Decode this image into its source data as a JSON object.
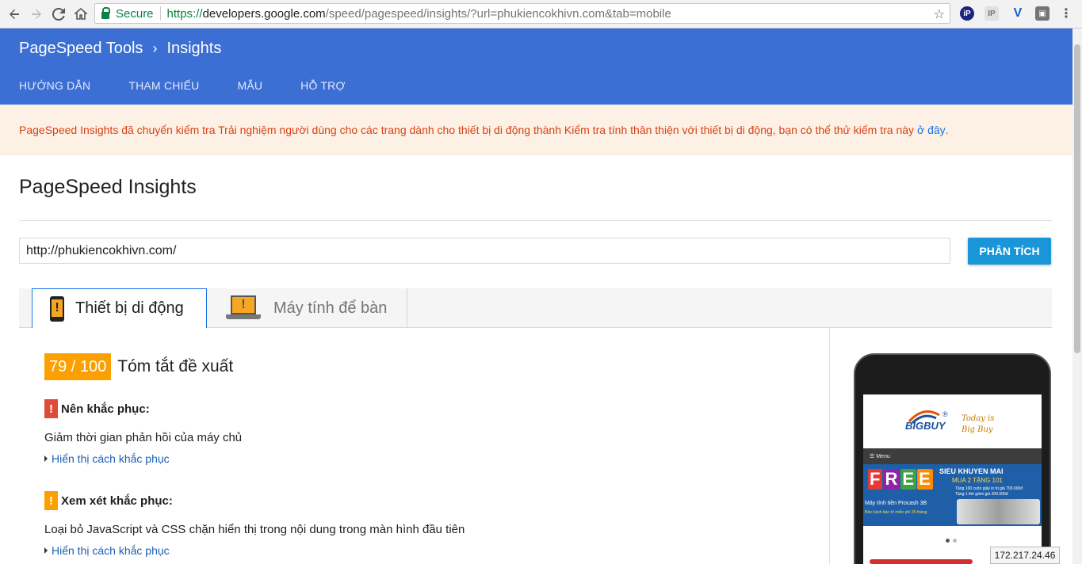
{
  "browser": {
    "secure_label": "Secure",
    "url_https": "https://",
    "url_host": "developers.google.com",
    "url_rest": "/speed/pagespeed/insights/?url=phukiencokhivn.com&tab=mobile",
    "back_icon": "arrow-left-icon",
    "forward_icon": "arrow-right-icon",
    "reload_icon": "reload-icon",
    "home_icon": "home-icon",
    "star_icon": "star-icon"
  },
  "header": {
    "crumb_root": "PageSpeed Tools",
    "crumb_current": "Insights",
    "nav": [
      "HƯỚNG DẪN",
      "THAM CHIẾU",
      "MẪU",
      "HỖ TRỢ"
    ]
  },
  "notice": {
    "text": "PageSpeed Insights đã chuyển kiểm tra Trải nghiệm người dùng cho các trang dành cho thiết bị di động thành Kiểm tra tính thân thiện với thiết bị di động, bạn có thể thử kiểm tra này",
    "link": "ở đây",
    "tail": "."
  },
  "page": {
    "title": "PageSpeed Insights",
    "url_value": "http://phukiencokhivn.com/",
    "analyze_label": "PHÂN TÍCH"
  },
  "tabs": {
    "mobile": "Thiết bị di động",
    "desktop": "Máy tính để bàn"
  },
  "report": {
    "score": "79 / 100",
    "summary_label": "Tóm tắt đề xuất",
    "should_fix": {
      "heading": "Nên khắc phục:",
      "rule": "Giảm thời gian phản hồi của máy chủ",
      "link": "Hiển thị cách khắc phục"
    },
    "consider_fix": {
      "heading": "Xem xét khắc phục:",
      "rule": "Loại bỏ JavaScript và CSS chặn hiển thị trong nội dung trong màn hình đầu tiên",
      "link": "Hiển thị cách khắc phục"
    }
  },
  "preview": {
    "logo": "BIGBUY",
    "reg": "®",
    "slogan_1": "Today is",
    "slogan_2": "Big Buy",
    "menu": "☰ Menu",
    "free_letters": [
      "F",
      "R",
      "E",
      "E"
    ],
    "sale_1": "SIEU KHUYEN MAI",
    "sale_2": "MUA 2 TẶNG 101",
    "sale_3a": "Tặng 100 cuộn giấy in trị giá 700.000đ",
    "sale_3b": "Tặng 1 thẻ giảm giá 200.000đ",
    "product": "Máy tính tiền Procash 3B",
    "product_note": "Bảo hành bảo trì miễn phí 25 tháng"
  },
  "tooltip": {
    "ip": "172.217.24.46"
  }
}
